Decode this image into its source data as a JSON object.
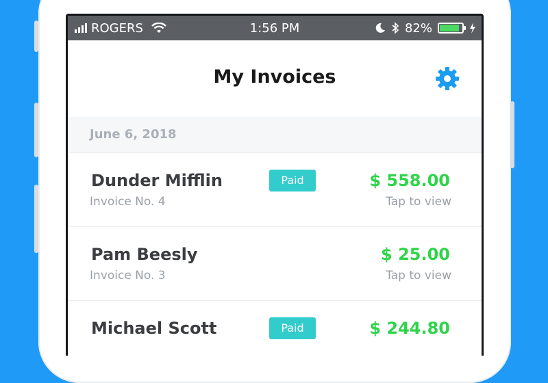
{
  "status_bar": {
    "carrier": "ROGERS",
    "time": "1:56 PM",
    "battery_percent": "82%",
    "battery_level": 0.82,
    "icons": [
      "signal-icon",
      "wifi-icon",
      "moon-icon",
      "bluetooth-icon",
      "battery-icon",
      "charging-icon"
    ]
  },
  "nav": {
    "title": "My Invoices",
    "settings_icon": "gear-icon",
    "accent_color": "#1a9cf0"
  },
  "section": {
    "date": "June 6, 2018"
  },
  "invoices": [
    {
      "client": "Dunder Mifflin",
      "invoice_no": "Invoice No. 4",
      "status": "Paid",
      "amount": "$ 558.00",
      "action": "Tap to view"
    },
    {
      "client": "Pam Beesly",
      "invoice_no": "Invoice No. 3",
      "status": "",
      "amount": "$ 25.00",
      "action": "Tap to view"
    },
    {
      "client": "Michael Scott",
      "invoice_no": "",
      "status": "Paid",
      "amount": "$ 244.80",
      "action": ""
    }
  ],
  "colors": {
    "background": "#1f9bf7",
    "paid_badge": "#33cccc",
    "amount": "#2fd44a",
    "status_bar": "#5b5e63"
  }
}
